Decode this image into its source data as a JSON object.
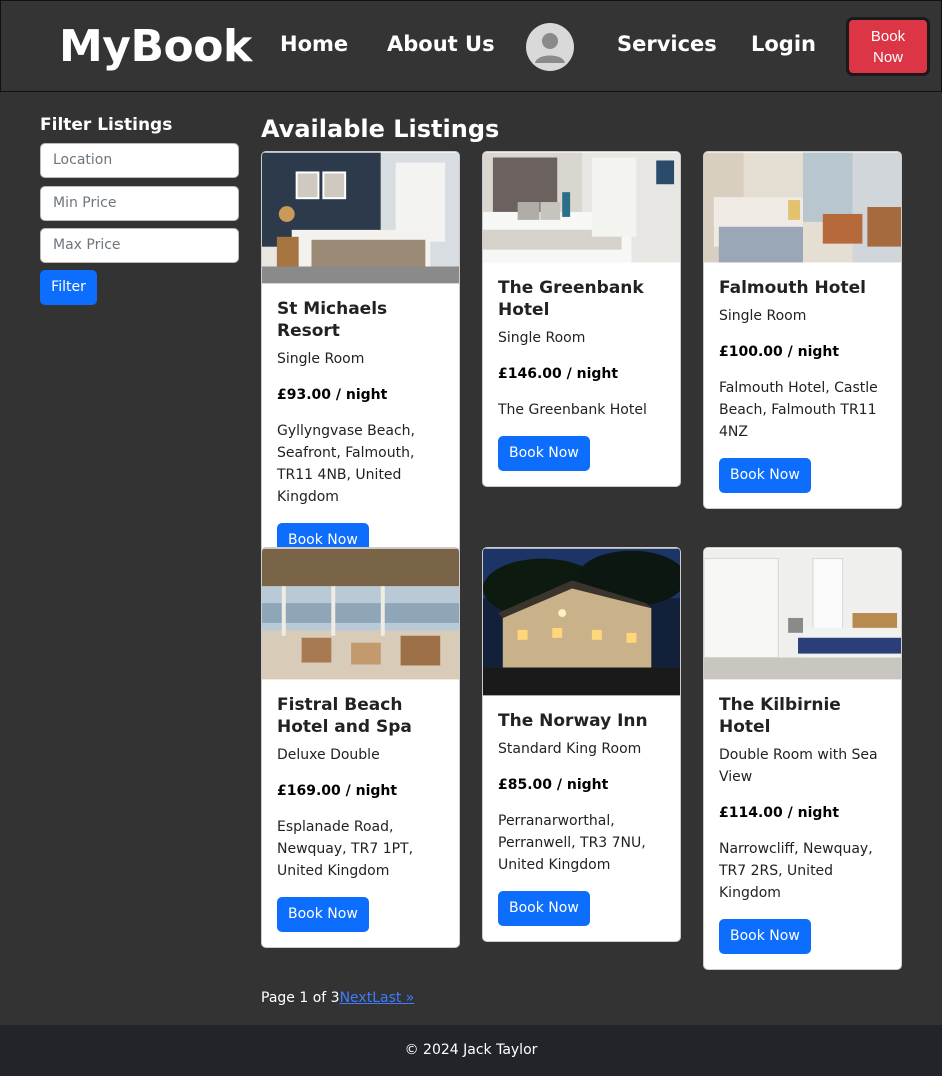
{
  "header": {
    "logo": "MyBook",
    "nav": [
      "Home",
      "About Us",
      "Services",
      "Login"
    ],
    "book_button_line1": "Book",
    "book_button_line2": "Now",
    "avatar_icon": "user-avatar-icon"
  },
  "sidebar": {
    "title": "Filter Listings",
    "location_placeholder": "Location",
    "min_price_placeholder": "Min Price",
    "max_price_placeholder": "Max Price",
    "filter_label": "Filter"
  },
  "main": {
    "title": "Available Listings",
    "book_label": "Book Now",
    "listings": [
      {
        "name": "St Michaels Resort",
        "room": "Single Room",
        "price": "£93.00 / night",
        "address": "Gyllyngvase Beach, Seafront, Falmouth, TR11 4NB, United Kingdom"
      },
      {
        "name": "The Greenbank Hotel",
        "room": "Single Room",
        "price": "£146.00 / night",
        "address": "The Greenbank Hotel"
      },
      {
        "name": "Falmouth Hotel",
        "room": "Single Room",
        "price": "£100.00 / night",
        "address": "Falmouth Hotel, Castle Beach, Falmouth TR11 4NZ"
      },
      {
        "name": "Fistral Beach Hotel and Spa",
        "room": "Deluxe Double",
        "price": "£169.00 / night",
        "address": "Esplanade Road, Newquay, TR7 1PT, United Kingdom"
      },
      {
        "name": "The Norway Inn",
        "room": "Standard King Room",
        "price": "£85.00 / night",
        "address": "Perranarworthal, Perranwell, TR3 7NU, United Kingdom"
      },
      {
        "name": "The Kilbirnie Hotel",
        "room": "Double Room with Sea View",
        "price": "£114.00 / night",
        "address": "Narrowcliff, Newquay, TR7 2RS, United Kingdom"
      }
    ]
  },
  "pagination": {
    "text": "Page 1 of 3",
    "next": "Next",
    "last": "Last »"
  },
  "footer": {
    "text": "© 2024 Jack Taylor"
  }
}
